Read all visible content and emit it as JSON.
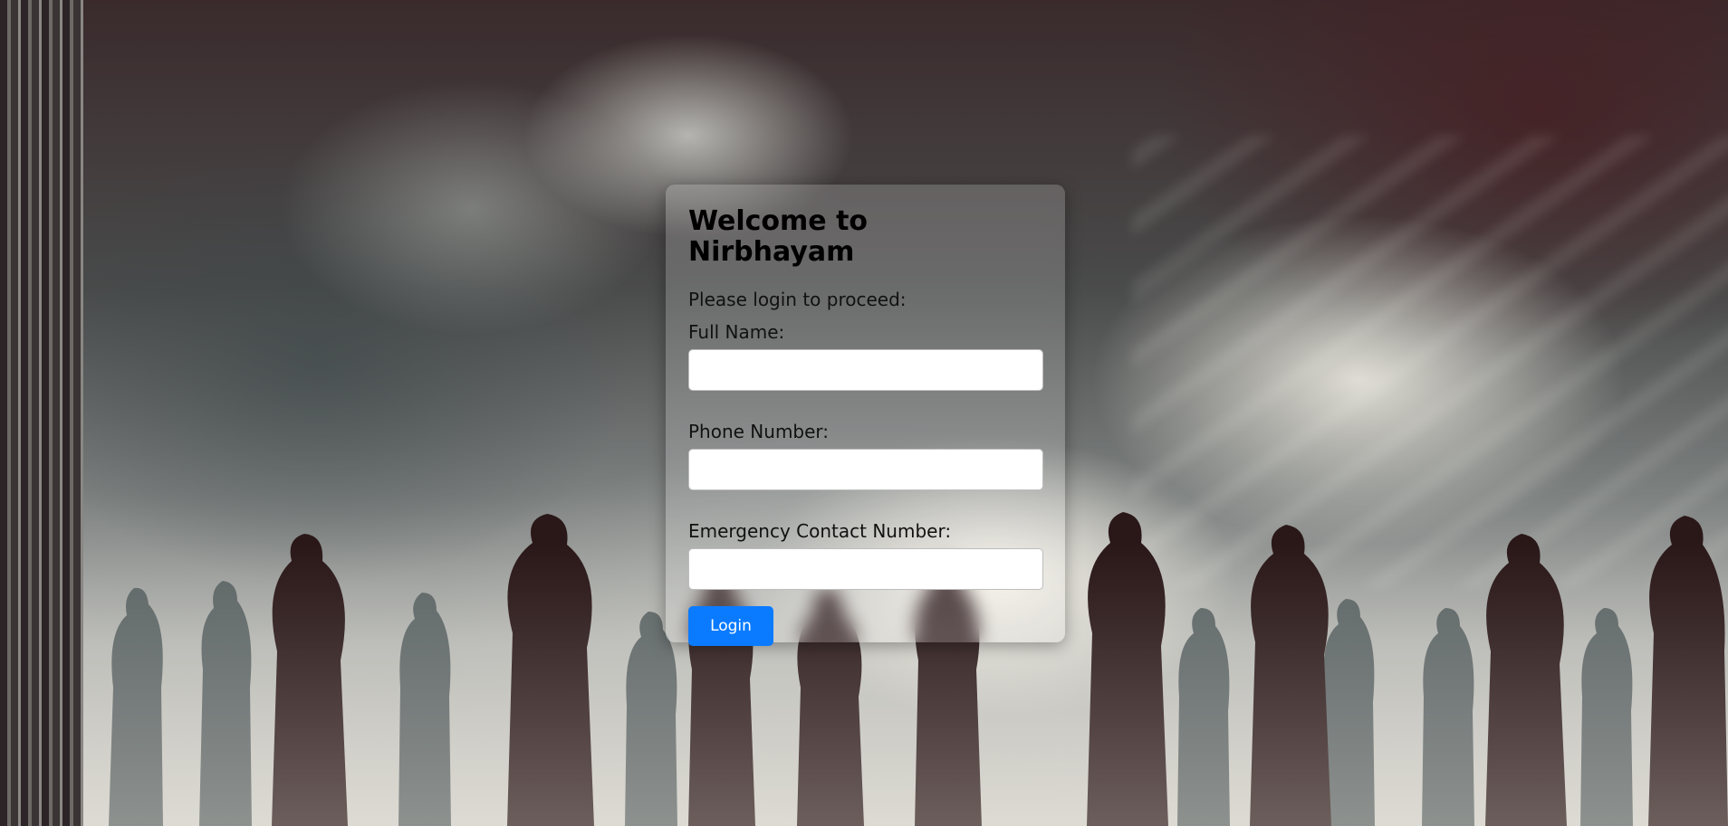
{
  "page": {
    "title": "Welcome to Nirbhayam",
    "subtitle": "Please login to proceed:"
  },
  "form": {
    "full_name": {
      "label": "Full Name:",
      "value": "",
      "placeholder": ""
    },
    "phone": {
      "label": "Phone Number:",
      "value": "",
      "placeholder": ""
    },
    "emergency": {
      "label": "Emergency Contact Number:",
      "value": "",
      "placeholder": ""
    },
    "submit_label": "Login"
  },
  "colors": {
    "button": "#0a7bff",
    "card_background": "rgba(255,255,255,0.18)"
  }
}
